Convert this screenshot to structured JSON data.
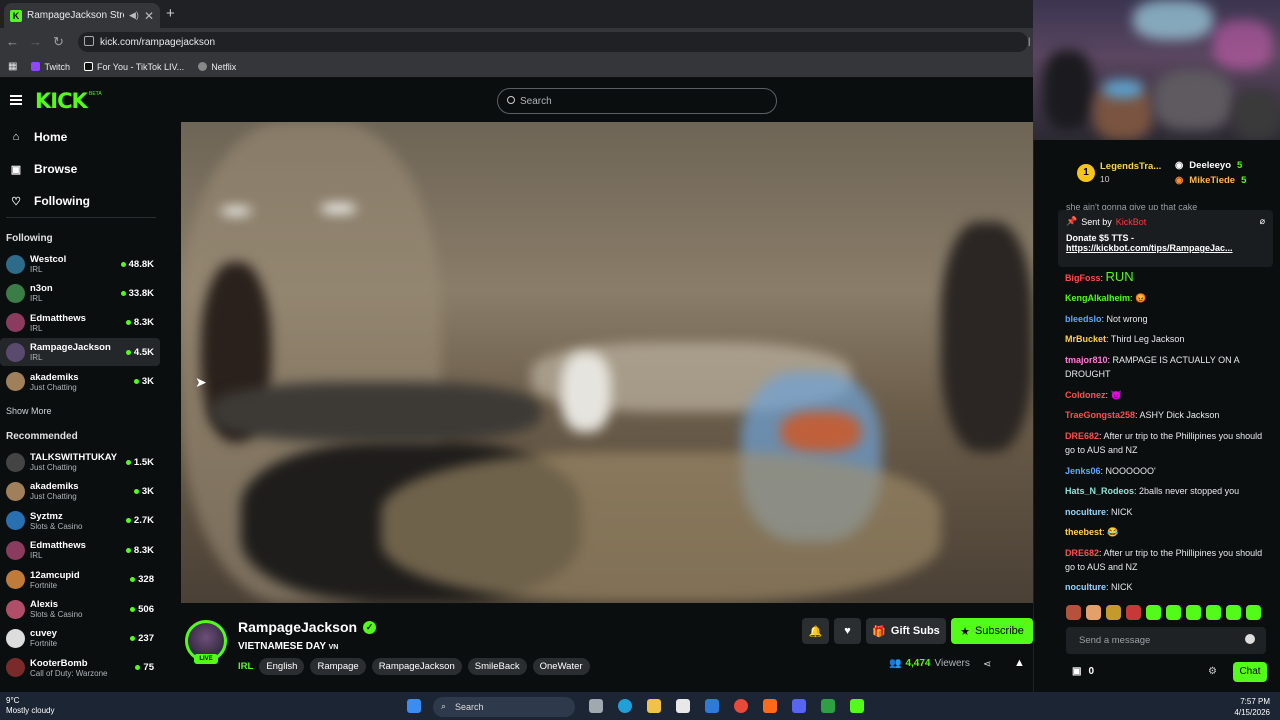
{
  "browser": {
    "tab_title": "RampageJackson Stream -",
    "url": "kick.com/rampagejackson",
    "bookmarks": [
      "Twitch",
      "For You - TikTok LIV...",
      "Netflix"
    ]
  },
  "header": {
    "logo": "KICK",
    "beta": "BETA",
    "search_placeholder": "Search"
  },
  "sidebar": {
    "nav": [
      {
        "label": "Home",
        "icon": "home-icon"
      },
      {
        "label": "Browse",
        "icon": "browse-icon"
      },
      {
        "label": "Following",
        "icon": "heart-icon"
      }
    ],
    "following_title": "Following",
    "following": [
      {
        "name": "Westcol",
        "category": "IRL",
        "viewers": "48.8K",
        "color": "#2e6b8a"
      },
      {
        "name": "n3on",
        "category": "IRL",
        "viewers": "33.8K",
        "color": "#3a7d45"
      },
      {
        "name": "Edmatthews",
        "category": "IRL",
        "viewers": "8.3K",
        "color": "#8a3b5e"
      },
      {
        "name": "RampageJackson",
        "category": "IRL",
        "viewers": "4.5K",
        "color": "#5a4a6e"
      },
      {
        "name": "akademiks",
        "category": "Just Chatting",
        "viewers": "3K",
        "color": "#a0805a"
      }
    ],
    "show_more": "Show More",
    "recommended_title": "Recommended",
    "recommended": [
      {
        "name": "TALKSWITHTUKAY",
        "category": "Just Chatting",
        "viewers": "1.5K",
        "color": "#444"
      },
      {
        "name": "akademiks",
        "category": "Just Chatting",
        "viewers": "3K",
        "color": "#a0805a"
      },
      {
        "name": "Syztmz",
        "category": "Slots & Casino",
        "viewers": "2.7K",
        "color": "#2a6fb0"
      },
      {
        "name": "Edmatthews",
        "category": "IRL",
        "viewers": "8.3K",
        "color": "#8a3b5e"
      },
      {
        "name": "12amcupid",
        "category": "Fortnite",
        "viewers": "328",
        "color": "#c07a3a"
      },
      {
        "name": "Alexis",
        "category": "Slots & Casino",
        "viewers": "506",
        "color": "#b04e6a"
      },
      {
        "name": "cuvey",
        "category": "Fortnite",
        "viewers": "237",
        "color": "#ddd"
      },
      {
        "name": "KooterBomb",
        "category": "Call of Duty: Warzone",
        "viewers": "75",
        "color": "#7a2a2a"
      }
    ]
  },
  "stream": {
    "channel_name": "RampageJackson",
    "live": "LIVE",
    "title": "VIETNAMESE DAY",
    "title_flag": "VN",
    "category": "IRL",
    "tags": [
      "English",
      "Rampage",
      "RampageJackson",
      "SmileBack",
      "OneWater"
    ],
    "gift_label": "Gift Subs",
    "subscribe_label": "Subscribe",
    "viewers": "4,474",
    "viewers_label": "Viewers"
  },
  "chat": {
    "leaderboard": [
      {
        "rank": "1",
        "name": "LegendsTra...",
        "count": "10"
      },
      {
        "name": "Deeleeyo",
        "count": "5"
      },
      {
        "name": "MikeTiede",
        "count": "5"
      }
    ],
    "truncated_message": "she ain't gonna give up that cake",
    "pinned": {
      "sent_by_label": "Sent by",
      "sender": "KickBot",
      "message": "Donate $5 TTS -",
      "link": "https://kickbot.com/tips/RampageJac..."
    },
    "messages": [
      {
        "user": "BigFoss",
        "text": "RUN",
        "color": "#ff4d4d"
      },
      {
        "user": "KengAlkalheim",
        "text": "😡",
        "color": "#53fc18"
      },
      {
        "user": "bleedslo",
        "text": "Not wrong",
        "color": "#5ea8ff"
      },
      {
        "user": "MrBucket",
        "text": "Third Leg Jackson",
        "color": "#ffd24d"
      },
      {
        "user": "tmajor810",
        "text": "RAMPAGE IS ACTUALLY ON A DROUGHT",
        "color": "#ff7ad9"
      },
      {
        "user": "Coldonez",
        "text": "😈",
        "color": "#ff4d4d"
      },
      {
        "user": "TraeGongsta258",
        "text": "ASHY Dick Jackson",
        "color": "#ff4d4d"
      },
      {
        "user": "DRE682",
        "text": "After ur trip to the Phillipines you should go to AUS and NZ",
        "color": "#ff4d4d"
      },
      {
        "user": "Jenks06",
        "text": "NOOOOOO'",
        "color": "#5ea8ff"
      },
      {
        "user": "Hats_N_Rodeos",
        "text": "2balls never stopped you",
        "color": "#8fe3d6"
      },
      {
        "user": "noculture",
        "text": "NICK",
        "color": "#8fd6ff"
      },
      {
        "user": "theebest",
        "text": "😂",
        "color": "#ffd24d"
      },
      {
        "user": "DRE682",
        "text": "After ur trip to the Phillipines you should go to AUS and NZ",
        "color": "#ff4d4d"
      },
      {
        "user": "noculture",
        "text": "NICK",
        "color": "#8fd6ff"
      }
    ],
    "input_placeholder": "Send a message",
    "count": "0",
    "chat_button": "Chat"
  },
  "taskbar": {
    "temperature": "9°C",
    "weather": "Mostly cloudy",
    "search": "Search",
    "time": "7:57 PM",
    "date": "4/15/2026"
  }
}
